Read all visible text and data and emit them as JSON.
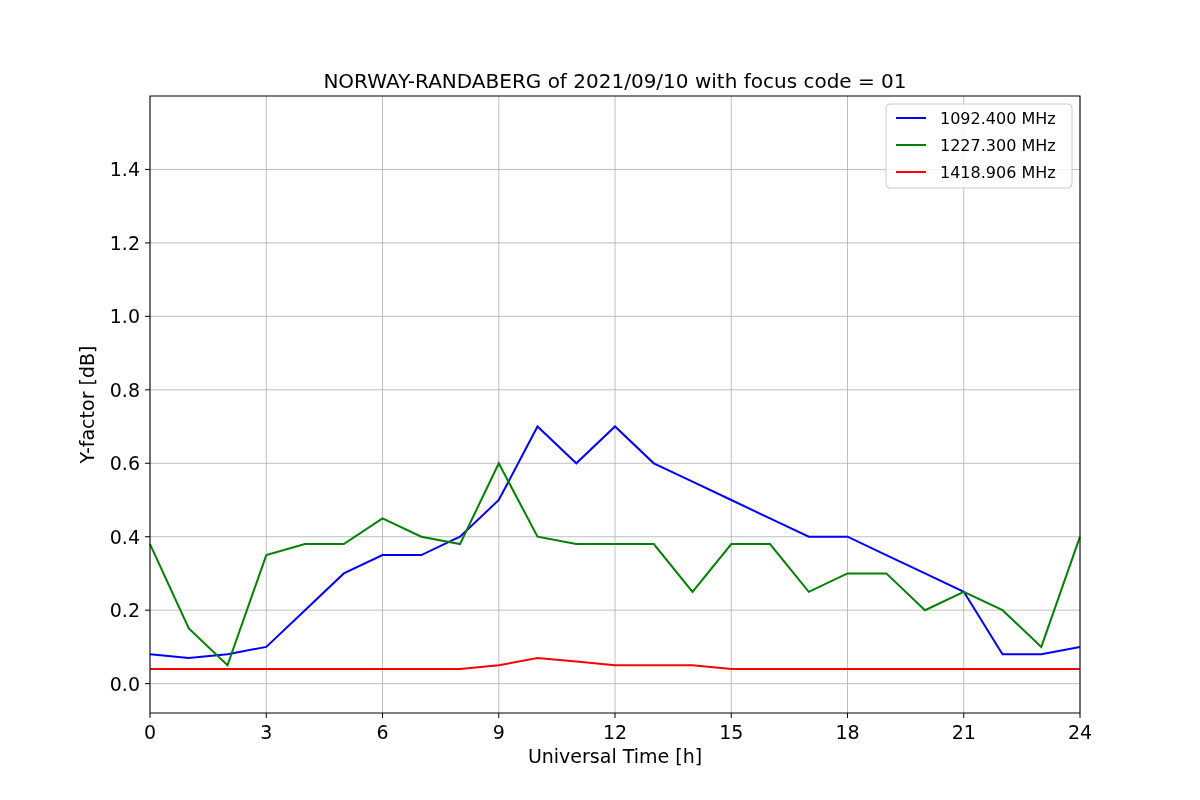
{
  "chart_data": {
    "type": "line",
    "title": "NORWAY-RANDABERG of 2021/09/10 with focus code = 01",
    "xlabel": "Universal Time [h]",
    "ylabel": "Y-factor [dB]",
    "x": [
      0,
      1,
      2,
      3,
      4,
      5,
      6,
      7,
      8,
      9,
      10,
      11,
      12,
      13,
      14,
      15,
      16,
      17,
      18,
      19,
      20,
      21,
      22,
      23,
      24
    ],
    "series": [
      {
        "name": "1092.400 MHz",
        "color": "#0000ff",
        "values": [
          0.08,
          0.07,
          0.08,
          0.1,
          0.2,
          0.3,
          0.35,
          0.35,
          0.4,
          0.5,
          0.7,
          0.6,
          0.7,
          0.6,
          0.55,
          0.5,
          0.45,
          0.4,
          0.4,
          0.35,
          0.3,
          0.25,
          0.08,
          0.08,
          0.1
        ]
      },
      {
        "name": "1227.300 MHz",
        "color": "#008000",
        "values": [
          0.38,
          0.15,
          0.05,
          0.35,
          0.38,
          0.38,
          0.45,
          0.4,
          0.38,
          0.6,
          0.4,
          0.38,
          0.38,
          0.38,
          0.25,
          0.38,
          0.38,
          0.25,
          0.3,
          0.3,
          0.2,
          0.25,
          0.2,
          0.1,
          0.4
        ]
      },
      {
        "name": "1418.906 MHz",
        "color": "#ff0000",
        "values": [
          0.04,
          0.04,
          0.04,
          0.04,
          0.04,
          0.04,
          0.04,
          0.04,
          0.04,
          0.05,
          0.07,
          0.06,
          0.05,
          0.05,
          0.05,
          0.04,
          0.04,
          0.04,
          0.04,
          0.04,
          0.04,
          0.04,
          0.04,
          0.04,
          0.04
        ]
      }
    ],
    "xlim": [
      0,
      24
    ],
    "ylim": [
      -0.08,
      1.6
    ],
    "grid": true,
    "legend": true,
    "xticks": [
      0,
      3,
      6,
      9,
      12,
      15,
      18,
      21,
      24
    ],
    "yticks": [
      {
        "value": 0,
        "label": "0.0"
      },
      {
        "value": 0.2,
        "label": "0.2"
      },
      {
        "value": 0.4,
        "label": "0.4"
      },
      {
        "value": 0.6,
        "label": "0.6"
      },
      {
        "value": 0.8,
        "label": "0.8"
      },
      {
        "value": 1,
        "label": "1.0"
      },
      {
        "value": 1.2,
        "label": "1.2"
      },
      {
        "value": 1.4,
        "label": "1.4"
      }
    ]
  }
}
